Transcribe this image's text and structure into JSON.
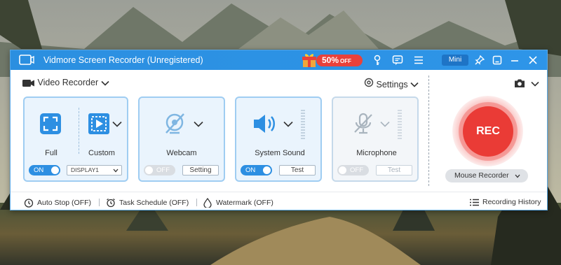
{
  "window": {
    "title": "Vidmore Screen Recorder (Unregistered)",
    "promo_text": "50%",
    "promo_suffix": "OFF",
    "mini_label": "Mini"
  },
  "icons": {
    "logo": "screen-recorder-logo-icon",
    "gift": "gift-icon",
    "key": "key-icon",
    "feedback": "chat-bubble-icon",
    "menu": "menu-icon",
    "pin": "pin-icon",
    "shrink": "restore-icon",
    "minimize": "minimize-icon",
    "close": "close-icon",
    "camera": "camera-icon",
    "settings": "gear-icon"
  },
  "toolbar": {
    "mode_label": "Video Recorder",
    "settings_label": "Settings"
  },
  "display": {
    "full_label": "Full",
    "custom_label": "Custom",
    "toggle": "ON",
    "display_select": "DISPLAY1"
  },
  "webcam": {
    "label": "Webcam",
    "toggle": "OFF",
    "button": "Setting"
  },
  "system_sound": {
    "label": "System Sound",
    "toggle": "ON",
    "button": "Test"
  },
  "microphone": {
    "label": "Microphone",
    "toggle": "OFF",
    "button": "Test"
  },
  "record": {
    "rec_label": "REC",
    "mouse_recorder": "Mouse Recorder"
  },
  "bottom": {
    "auto_stop": "Auto Stop (OFF)",
    "task_schedule": "Task Schedule (OFF)",
    "watermark": "Watermark (OFF)",
    "history": "Recording History"
  },
  "colors": {
    "titlebar": "#2b8fe0",
    "accent": "#2d8fe2",
    "rec": "#ea3b36",
    "promo": "#e9413a",
    "panel_bg": "#eaf4fd"
  }
}
